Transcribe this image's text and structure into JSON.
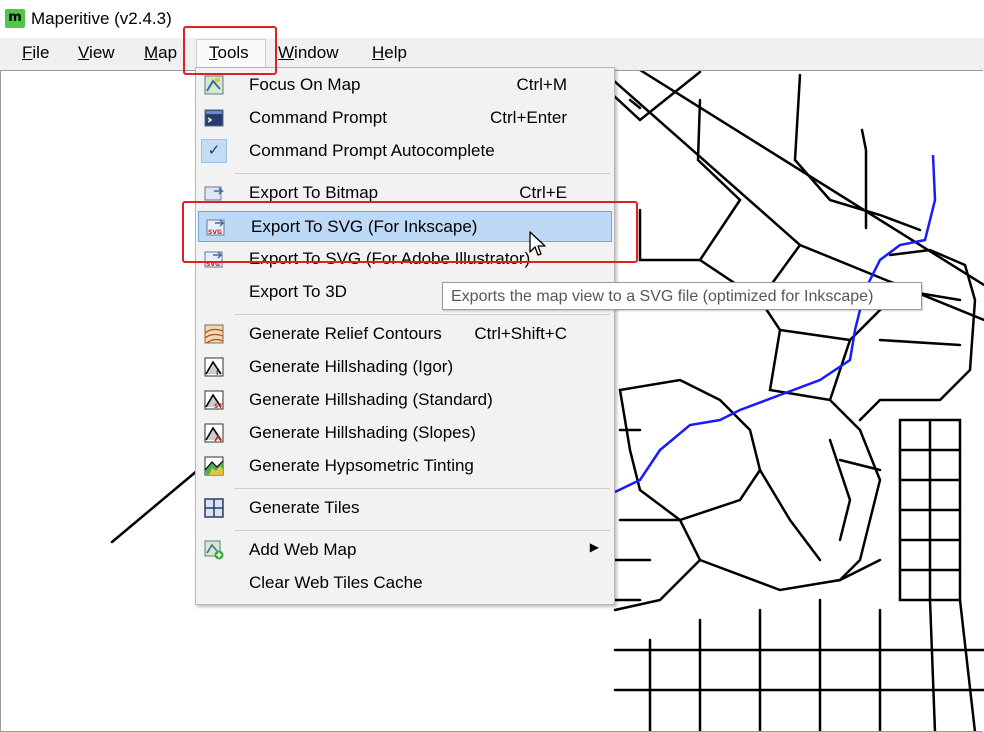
{
  "window": {
    "app_icon_text": "m",
    "title": "Maperitive (v2.4.3)"
  },
  "menubar": {
    "items": [
      {
        "label": "File",
        "mnemonic": "F"
      },
      {
        "label": "View",
        "mnemonic": "V"
      },
      {
        "label": "Map",
        "mnemonic": "M"
      },
      {
        "label": "Tools",
        "mnemonic": "T"
      },
      {
        "label": "Window",
        "mnemonic": "W"
      },
      {
        "label": "Help",
        "mnemonic": "H"
      }
    ]
  },
  "tools_menu": {
    "items": [
      {
        "label": "Focus On Map",
        "shortcut": "Ctrl+M",
        "icon": "map-focus-icon"
      },
      {
        "label": "Command Prompt",
        "shortcut": "Ctrl+Enter",
        "icon": "console-icon"
      },
      {
        "label": "Command Prompt Autocomplete",
        "shortcut": "",
        "icon": "checkmark-icon",
        "checked": true
      },
      {
        "label": "Export To Bitmap",
        "shortcut": "Ctrl+E",
        "icon": "bitmap-export-icon"
      },
      {
        "label": "Export To SVG (For Inkscape)",
        "shortcut": "",
        "icon": "svg-export-icon",
        "selected": true
      },
      {
        "label": "Export To SVG (For Adobe Illustrator)",
        "shortcut": "",
        "icon": "svg-export-icon"
      },
      {
        "label": "Export To 3D",
        "shortcut": "",
        "icon": ""
      },
      {
        "label": "Generate Relief Contours",
        "shortcut": "Ctrl+Shift+C",
        "icon": "contours-icon"
      },
      {
        "label": "Generate Hillshading (Igor)",
        "shortcut": "",
        "icon": "hillshade-icon"
      },
      {
        "label": "Generate Hillshading (Standard)",
        "shortcut": "",
        "icon": "hillshade-icon"
      },
      {
        "label": "Generate Hillshading (Slopes)",
        "shortcut": "",
        "icon": "hillshade-icon"
      },
      {
        "label": "Generate Hypsometric Tinting",
        "shortcut": "",
        "icon": "hypsometric-icon"
      },
      {
        "label": "Generate Tiles",
        "shortcut": "",
        "icon": "tiles-icon"
      },
      {
        "label": "Add Web Map",
        "shortcut": "",
        "icon": "web-map-icon",
        "submenu": true
      },
      {
        "label": "Clear Web Tiles Cache",
        "shortcut": "",
        "icon": ""
      }
    ]
  },
  "tooltip": {
    "text": "Exports the map view to a SVG file (optimized for Inkscape)"
  },
  "colors": {
    "highlight": "#e02020",
    "selection_bg": "#bdd9f5",
    "selection_border": "#6fa6dc",
    "river": "#1a1aff",
    "road": "#000000"
  }
}
